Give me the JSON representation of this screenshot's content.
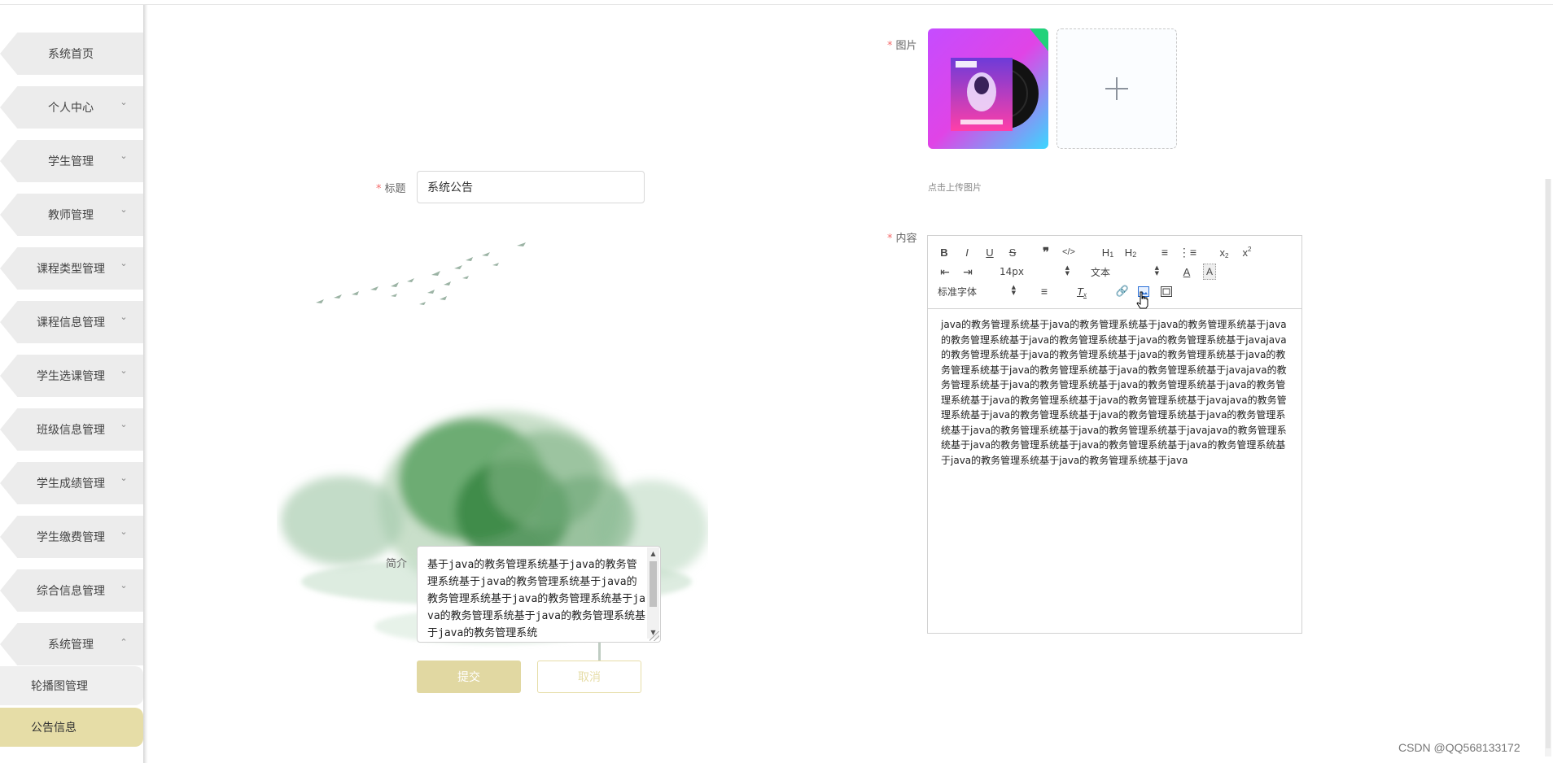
{
  "sidebar": {
    "items": [
      {
        "label": "系统首页",
        "has_chevron": false
      },
      {
        "label": "个人中心",
        "has_chevron": true
      },
      {
        "label": "学生管理",
        "has_chevron": true
      },
      {
        "label": "教师管理",
        "has_chevron": true
      },
      {
        "label": "课程类型管理",
        "has_chevron": true
      },
      {
        "label": "课程信息管理",
        "has_chevron": true
      },
      {
        "label": "学生选课管理",
        "has_chevron": true
      },
      {
        "label": "班级信息管理",
        "has_chevron": true
      },
      {
        "label": "学生成绩管理",
        "has_chevron": true
      },
      {
        "label": "学生缴费管理",
        "has_chevron": true
      },
      {
        "label": "综合信息管理",
        "has_chevron": true
      },
      {
        "label": "系统管理",
        "has_chevron": true,
        "expanded": true
      }
    ],
    "sub_items": [
      {
        "label": "轮播图管理",
        "active": false
      },
      {
        "label": "公告信息",
        "active": true
      }
    ],
    "active_color": "#e6dda7"
  },
  "form": {
    "title_label": "标题",
    "title_value": "系统公告",
    "summary_label": "简介",
    "summary_value": "基于java的教务管理系统基于java的教务管理系统基于java的教务管理系统基于java的教务管理系统基于java的教务管理系统基于java的教务管理系统基于java的教务管理系统基于java的教务管理系统",
    "image_label": "图片",
    "upload_hint": "点击上传图片",
    "content_label": "内容",
    "required_mark": "*",
    "submit_label": "提交",
    "cancel_label": "取消"
  },
  "editor": {
    "font_size": "14px",
    "header_select": "文本",
    "font_family": "标准字体",
    "content": "java的教务管理系统基于java的教务管理系统基于java的教务管理系统基于java的教务管理系统基于java的教务管理系统基于java的教务管理系统基于javajava的教务管理系统基于java的教务管理系统基于java的教务管理系统基于java的教务管理系统基于java的教务管理系统基于java的教务管理系统基于javajava的教务管理系统基于java的教务管理系统基于java的教务管理系统基于java的教务管理系统基于java的教务管理系统基于java的教务管理系统基于javajava的教务管理系统基于java的教务管理系统基于java的教务管理系统基于java的教务管理系统基于java的教务管理系统基于java的教务管理系统基于javajava的教务管理系统基于java的教务管理系统基于java的教务管理系统基于java的教务管理系统基于java的教务管理系统基于java的教务管理系统基于java"
  },
  "watermark": "CSDN @QQ568133172",
  "colors": {
    "accent": "#e6dda7",
    "submit_bg": "#e1d8a2",
    "required": "#f56c6c"
  }
}
